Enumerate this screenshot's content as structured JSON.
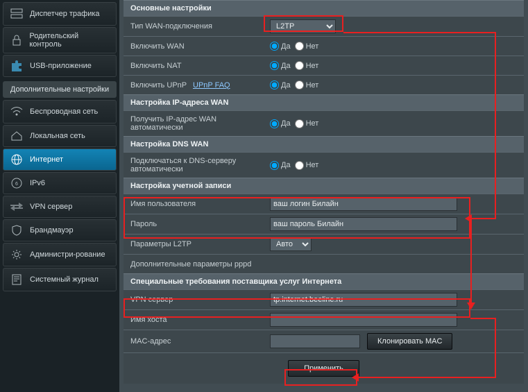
{
  "sidebar": {
    "top_items": [
      {
        "label": "Диспетчер трафика",
        "icon": "network"
      },
      {
        "label": "Родительский контроль",
        "icon": "lock"
      },
      {
        "label": "USB-приложение",
        "icon": "puzzle"
      }
    ],
    "section_title": "Дополнительные настройки",
    "items": [
      {
        "label": "Беспроводная сеть",
        "icon": "wifi"
      },
      {
        "label": "Локальная сеть",
        "icon": "home"
      },
      {
        "label": "Интернет",
        "icon": "globe",
        "active": true
      },
      {
        "label": "IPv6",
        "icon": "ipv6"
      },
      {
        "label": "VPN сервер",
        "icon": "double-arrow"
      },
      {
        "label": "Брандмауэр",
        "icon": "shield"
      },
      {
        "label": "Администри-рование",
        "icon": "gear"
      },
      {
        "label": "Системный журнал",
        "icon": "log"
      }
    ]
  },
  "groups": {
    "basic": {
      "title": "Основные настройки",
      "wan_type_label": "Тип WAN-подключения",
      "wan_type_value": "L2TP",
      "enable_wan": "Включить WAN",
      "enable_nat": "Включить NAT",
      "enable_upnp": "Включить UPnP",
      "upnp_faq": "UPnP  FAQ",
      "yes": "Да",
      "no": "Нет"
    },
    "wan_ip": {
      "title": "Настройка IP-адреса WAN",
      "auto_label": "Получить IP-адрес WAN автоматически"
    },
    "dns": {
      "title": "Настройка DNS WAN",
      "auto_label": "Подключаться к DNS-серверу автоматически"
    },
    "account": {
      "title": "Настройка учетной записи",
      "user_label": "Имя пользователя",
      "user_value": "ваш логин Билайн",
      "pass_label": "Пароль",
      "pass_value": "ваш пароль Билайн",
      "l2tp_params_label": "Параметры L2TP",
      "l2tp_params_value": "Авто",
      "ppp_extra": "Дополнительные параметры pppd"
    },
    "isp": {
      "title": "Специальные требования поставщика услуг Интернета",
      "vpn_label": "VPN сервер",
      "vpn_value": "tp.internet.beeline.ru",
      "host_label": "Имя хоста",
      "host_value": "",
      "mac_label": "MAC-адрес",
      "mac_value": "",
      "clone_mac": "Клонировать MAC"
    },
    "apply": "Применить"
  }
}
